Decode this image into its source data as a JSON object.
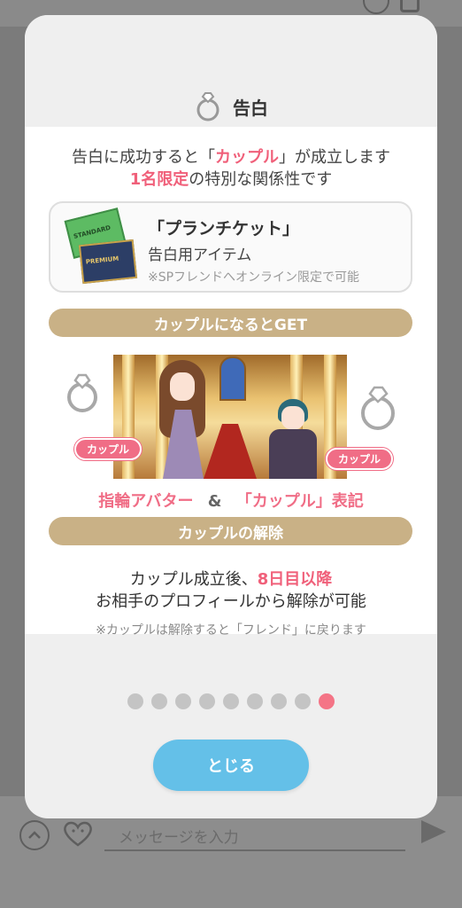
{
  "background": {
    "message_placeholder": "メッセージを入力"
  },
  "modal": {
    "title": "告白",
    "intro_line1_prefix": "告白に成功すると「",
    "intro_line1_highlight": "カップル",
    "intro_line1_suffix": "」が成立します",
    "intro_line2_highlight": "1名限定",
    "intro_line2_suffix": "の特別な関係性です",
    "ticket": {
      "title": "「プランチケット」",
      "subtitle": "告白用アイテム",
      "note": "※SPフレンドへオンライン限定で可能",
      "card1_text": "STANDARD",
      "card2_text": "PREMIUM"
    },
    "get_bar": "カップルになるとGET",
    "couple_tag_left": "カップル",
    "couple_tag_right": "カップル",
    "result_left": "指輪アバター",
    "result_amp": "&",
    "result_right": "「カップル」表記",
    "release_bar": "カップルの解除",
    "release_line1_prefix": "カップル成立後、",
    "release_line1_highlight": "8日目以降",
    "release_line2": "お相手のプロフィールから解除が可能",
    "release_note": "※カップルは解除すると「フレンド」に戻ります",
    "close_button": "とじる"
  },
  "pagination": {
    "total": 9,
    "active_index": 8
  },
  "colors": {
    "accent_pink": "#f06d86",
    "gold_bar": "#c9b186",
    "close_button": "#64c0e8"
  }
}
